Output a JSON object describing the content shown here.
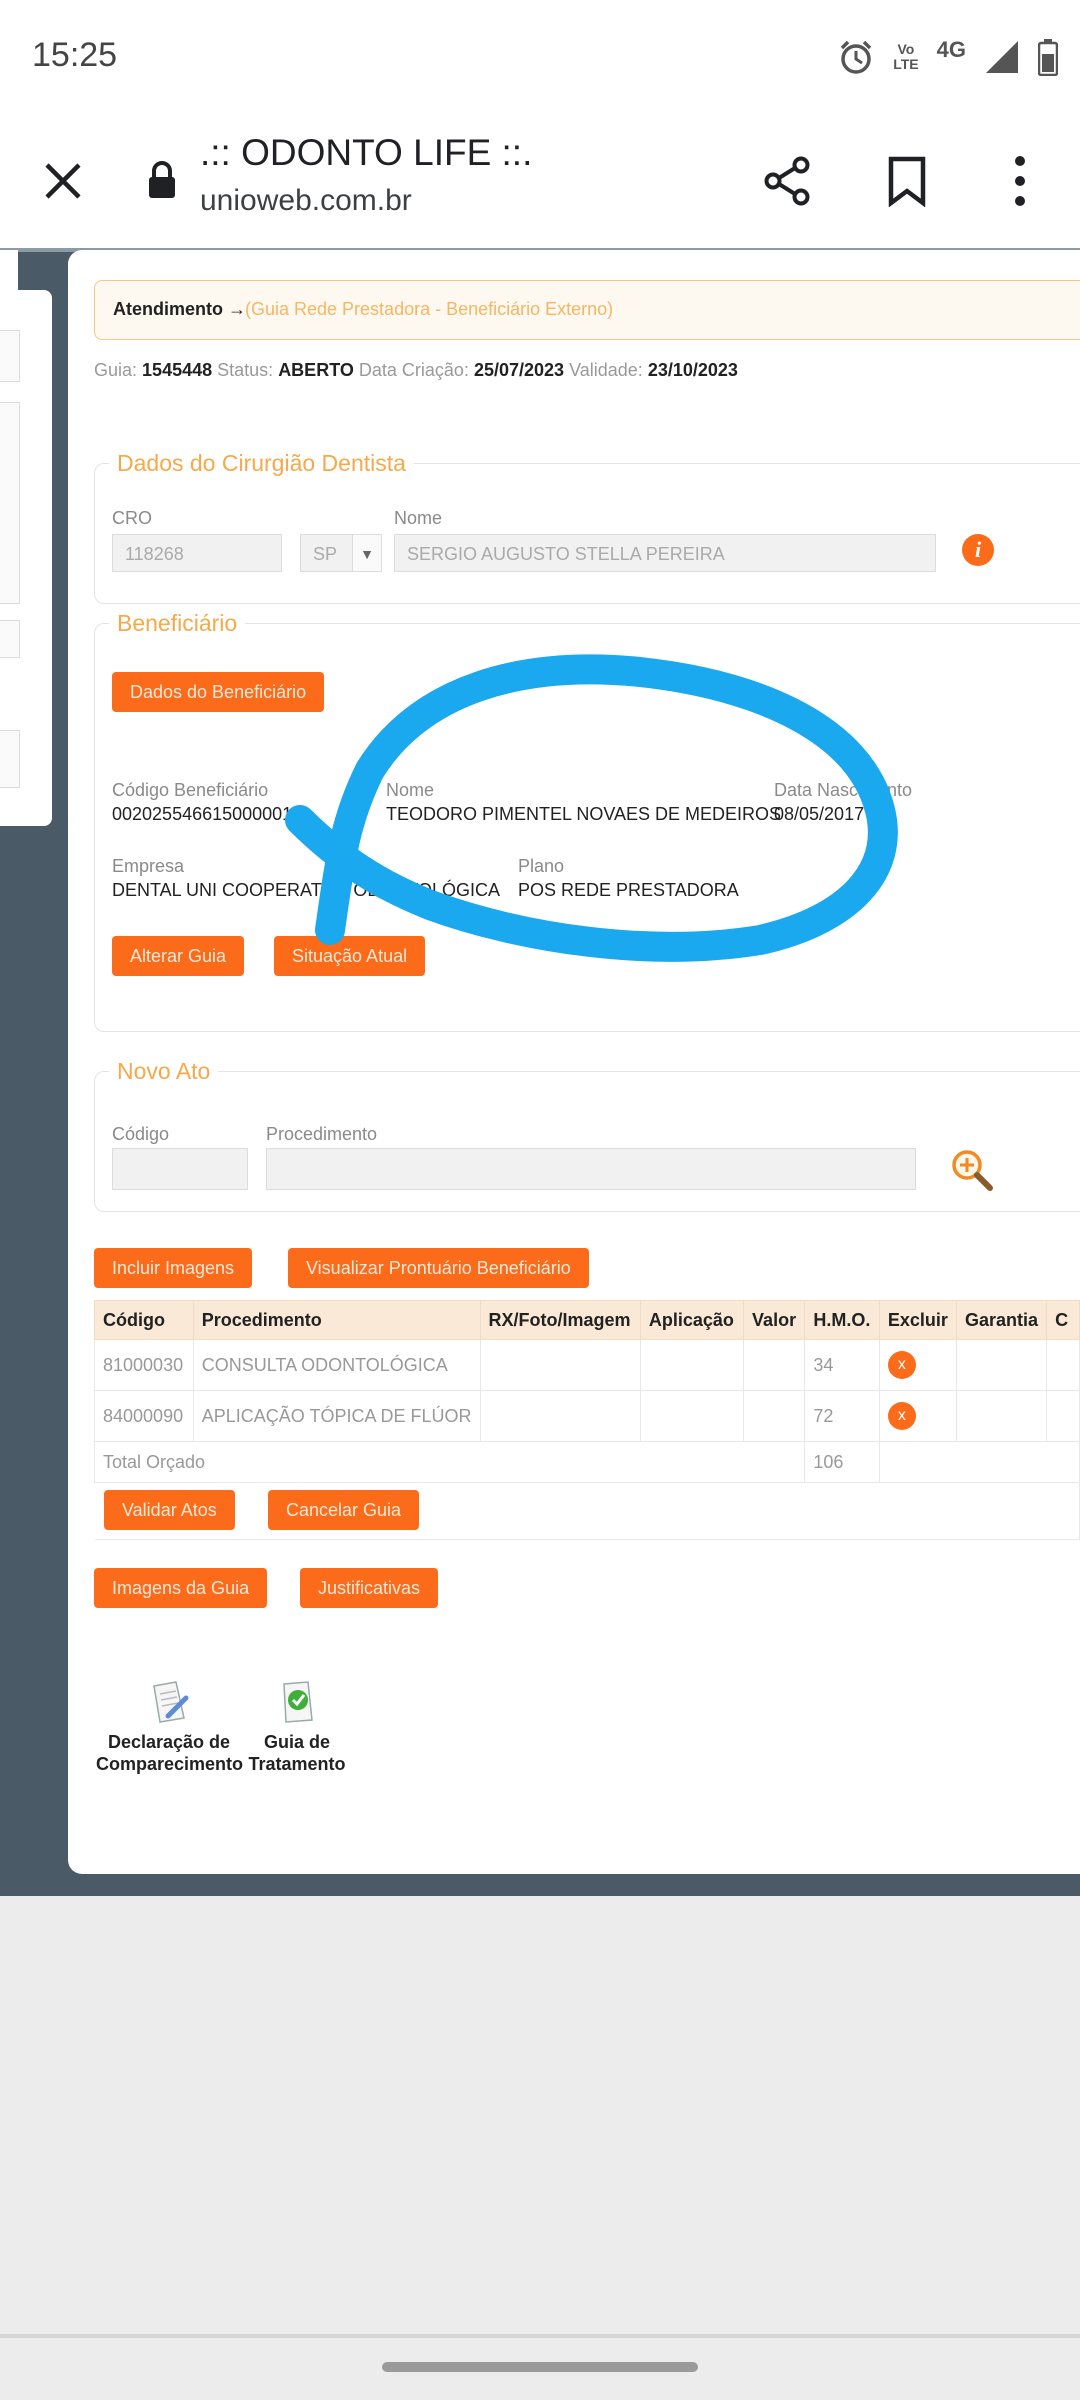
{
  "status_bar": {
    "time": "15:25",
    "volte": "Vo))\nLTE",
    "network": "4G"
  },
  "browser": {
    "title": ".:: ODONTO LIFE ::.",
    "url": "unioweb.com.br"
  },
  "breadcrumb": {
    "main": "Atendimento →",
    "sub": "(Guia Rede Prestadora - Beneficiário Externo)"
  },
  "guide_info": {
    "guia_label": "Guia:",
    "guia_value": "1545448",
    "status_label": "Status:",
    "status_value": "ABERTO",
    "criacao_label": "Data Criação:",
    "criacao_value": "25/07/2023",
    "validade_label": "Validade:",
    "validade_value": "23/10/2023"
  },
  "dentist": {
    "legend": "Dados do Cirurgião Dentista",
    "cro_label": "CRO",
    "cro_value": "118268",
    "uf_value": "SP",
    "nome_label": "Nome",
    "nome_value": "SERGIO AUGUSTO STELLA PEREIRA",
    "info_icon": "info-icon"
  },
  "beneficiary": {
    "legend": "Beneficiário",
    "dados_button": "Dados do Beneficiário",
    "codigo_label": "Código Beneficiário",
    "codigo_value": "002025546615000001",
    "nome_label": "Nome",
    "nome_value": "TEODORO PIMENTEL NOVAES DE MEDEIROS",
    "nasc_label": "Data Nascimento",
    "nasc_value": "08/05/2017",
    "empresa_label": "Empresa",
    "empresa_value": "DENTAL UNI COOPERATIVA ODONTOLÓGICA",
    "plano_label": "Plano",
    "plano_value": "POS REDE PRESTADORA",
    "alterar_button": "Alterar Guia",
    "situacao_button": "Situação Atual"
  },
  "novo_ato": {
    "legend": "Novo Ato",
    "codigo_label": "Código",
    "procedimento_label": "Procedimento",
    "search_icon": "magnifier-plus-icon"
  },
  "actions": {
    "incluir_imagens": "Incluir Imagens",
    "visualizar_prontuario": "Visualizar Prontuário Beneficiário"
  },
  "table": {
    "headers": [
      "Código",
      "Procedimento",
      "RX/Foto/Imagem",
      "Aplicação",
      "Valor",
      "H.M.O.",
      "Excluir",
      "Garantia",
      "C"
    ],
    "rows": [
      {
        "codigo": "81000030",
        "procedimento": "CONSULTA ODONTOLÓGICA",
        "rx": "",
        "aplicacao": "",
        "valor": "",
        "hmo": "34",
        "excluir": "x"
      },
      {
        "codigo": "84000090",
        "procedimento": "APLICAÇÃO TÓPICA DE FLÚOR",
        "rx": "",
        "aplicacao": "",
        "valor": "",
        "hmo": "72",
        "excluir": "x"
      }
    ],
    "total_label": "Total Orçado",
    "total_value": "106",
    "validar_button": "Validar Atos",
    "cancelar_button": "Cancelar Guia"
  },
  "bottom_buttons": {
    "imagens_guia": "Imagens da Guia",
    "justificativas": "Justificativas"
  },
  "documents": [
    {
      "line1": "Declaração de",
      "line2": "Comparecimento",
      "icon": "document-pencil-icon"
    },
    {
      "line1": "Guia de",
      "line2": "Tratamento",
      "icon": "document-check-icon"
    }
  ],
  "colors": {
    "accent": "#fb6b1a",
    "legend": "#f7a94a",
    "annotation": "#1aa8ee",
    "page_bg": "#4a5a66"
  }
}
